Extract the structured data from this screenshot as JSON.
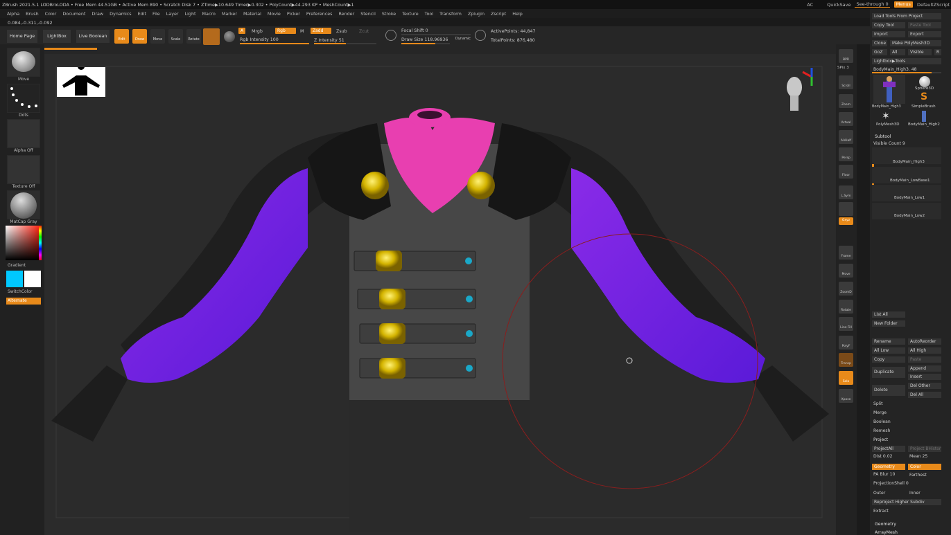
{
  "title_bar": {
    "info": "ZBrush 2021.5.1   LODBroLODA  •  Free Mem 44.51GB  •  Active Mem 890  •  Scratch Disk 7  •  ZTime▶10.649  Timer▶0.302  •  PolyCount▶44.293 KP  •  MeshCount▶1",
    "ac": "AC",
    "quicksave": "QuickSave",
    "see_through": "See-through  0",
    "menus_btn": "Menus",
    "default_script": "DefaultZScript"
  },
  "menu_bar": [
    "Alpha",
    "Brush",
    "Color",
    "Document",
    "Draw",
    "Dynamics",
    "Edit",
    "File",
    "Layer",
    "Light",
    "Macro",
    "Marker",
    "Material",
    "Movie",
    "Picker",
    "Preferences",
    "Render",
    "Stencil",
    "Stroke",
    "Texture",
    "Tool",
    "Transform",
    "Zplugin",
    "Zscript",
    "Help"
  ],
  "coords": "0.084,-0.311,-0.092",
  "nav": {
    "home": "Home Page",
    "lightbox": "LightBox",
    "live_boolean": "Live Boolean"
  },
  "tools": {
    "edit": "Edit",
    "draw": "Draw",
    "move": "Move",
    "scale": "Scale",
    "rotate": "Rotate"
  },
  "brush_opts": {
    "a": "A",
    "mrgb": "Mrgb",
    "rgb": "Rgb",
    "m": "M",
    "zadd": "Zadd",
    "zsub": "Zsub",
    "zcut": "Zcut",
    "rgb_intensity": "Rgb Intensity 100",
    "z_intensity": "Z Intensity 51",
    "focal_shift": "Focal Shift 0",
    "draw_size": "Draw Size 118.96936",
    "dynamic": "Dynamic",
    "active_points": "ActivePoints: 44,847",
    "total_points": "TotalPoints: 876,480",
    "rgb_intensity_level": 1.0,
    "z_intensity_level": 0.51
  },
  "left_shelf": {
    "brush": "Move",
    "stroke": "Dots",
    "alpha": "Alpha Off",
    "texture": "Texture Off",
    "material": "MatCap Gray",
    "gradient": "Gradient",
    "switch_color": "SwitchColor",
    "alternate": "Alternate",
    "main_color": "#00c8ff",
    "secondary_color": "#ffffff"
  },
  "right_shelf": [
    "BPR",
    "SPix 3",
    "Scroll",
    "Zoom",
    "Actual",
    "AAHalf",
    "Dynamic",
    "Persp",
    "Floor",
    "L.Sym",
    "",
    "Gxyz",
    "",
    "",
    "Frame",
    "Move",
    "ZoomD",
    "Rotate",
    "Line Fill",
    "PolyF",
    "Transp",
    "Ghost",
    "Solo",
    "Xpose"
  ],
  "spix": "SPix 3",
  "panel": {
    "load_tools": "Load Tools From Project",
    "copy_tool": "Copy Tool",
    "paste_tool": "Paste Tool",
    "import": "Import",
    "export": "Export",
    "clone": "Clone",
    "make_polymesh": "Make PolyMesh3D",
    "goz": "GoZ",
    "all": "All",
    "visible": "Visible",
    "r": "R",
    "lightbox_tools": "Lightbox▶Tools",
    "current_tool": "BodyMain_High3. 48",
    "tool_thumbs": [
      "BodyMain_High3",
      "Sphere3D",
      "SimpleBrush",
      "PolyMesh3D",
      "BodyMain_High2"
    ],
    "subtool": "Subtool",
    "visible_count": "Visible Count 9",
    "subtools": [
      "BodyMain_High3",
      "BodyMain_LowBase1",
      "BodyMain_Low1",
      "BodyMain_Low2"
    ],
    "list_all": "List All",
    "new_folder": "New Folder",
    "rename": "Rename",
    "auto_reorder": "AutoReorder",
    "all_low": "All Low",
    "all_high": "All High",
    "copy": "Copy",
    "paste": "Paste",
    "duplicate": "Duplicate",
    "append": "Append",
    "insert": "Insert",
    "delete": "Delete",
    "del_other": "Del Other",
    "del_all": "Del All",
    "split": "Split",
    "merge": "Merge",
    "boolean": "Boolean",
    "remesh": "Remesh",
    "project": "Project",
    "project_all": "ProjectAll",
    "project_bhistory": "Project BHistory",
    "dist": "Dist 0.02",
    "mean": "Mean 25",
    "geometry_btn": "Geometry",
    "color_btn": "Color",
    "pa_blur": "PA Blur 10",
    "farthest": "Farthest",
    "projection_shell": "ProjectionShell 0",
    "outer": "Outer",
    "inner": "Inner",
    "reproject": "Reproject Higher Subdiv",
    "extract": "Extract",
    "geometry_section": "Geometry",
    "arraymesh_section": "ArrayMesh"
  }
}
